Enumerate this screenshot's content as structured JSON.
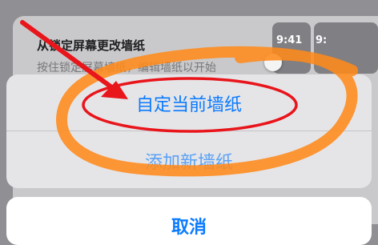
{
  "background_settings": {
    "title": "从锁定屏幕更改墙纸",
    "subtitle": "按住锁定屏幕墙纸，编辑墙纸以开始",
    "thumbnails": [
      {
        "time": "9:41"
      },
      {
        "time": "9:"
      }
    ]
  },
  "action_sheet": {
    "options": [
      {
        "label": "自定当前墙纸"
      },
      {
        "label": "添加新墙纸"
      }
    ],
    "cancel_label": "取消"
  },
  "colors": {
    "accent": "#0a7aff",
    "annotation_orange": "#ff8a1a",
    "annotation_red": "#e8151b"
  }
}
